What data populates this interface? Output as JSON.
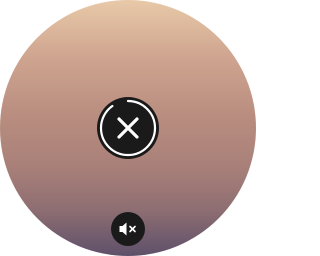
{
  "watch_screen": {
    "background_top_color": "#e8c9a8",
    "background_bottom_color": "#5e506a",
    "cancel_button": {
      "icon": "close-icon",
      "progress": 0.9,
      "button_color": "#1a1a1a",
      "ring_color": "#ffffff"
    },
    "mute_button": {
      "icon": "speaker-muted-icon",
      "button_color": "#1a1a1a"
    }
  }
}
